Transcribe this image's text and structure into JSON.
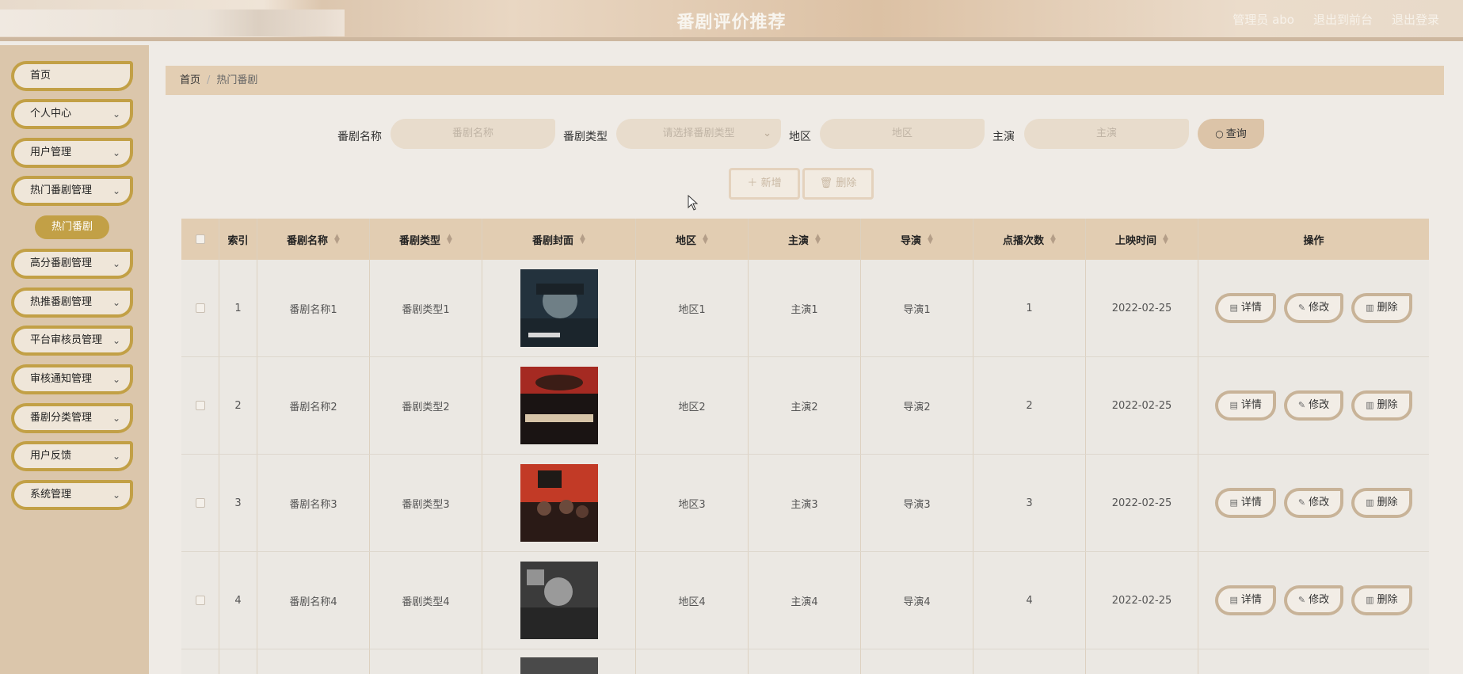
{
  "header": {
    "title": "番剧评价推荐",
    "user": "管理员 abo",
    "to_front": "退出到前台",
    "logout": "退出登录"
  },
  "sidebar": {
    "items": [
      {
        "label": "首页",
        "has_arrow": false
      },
      {
        "label": "个人中心",
        "has_arrow": true
      },
      {
        "label": "用户管理",
        "has_arrow": true
      },
      {
        "label": "热门番剧管理",
        "has_arrow": true
      },
      {
        "label": "高分番剧管理",
        "has_arrow": true
      },
      {
        "label": "热推番剧管理",
        "has_arrow": true
      },
      {
        "label": "平台审核员管理",
        "has_arrow": true
      },
      {
        "label": "审核通知管理",
        "has_arrow": true
      },
      {
        "label": "番剧分类管理",
        "has_arrow": true
      },
      {
        "label": "用户反馈",
        "has_arrow": true
      },
      {
        "label": "系统管理",
        "has_arrow": true
      }
    ],
    "active_sub": "热门番剧"
  },
  "breadcrumb": {
    "home": "首页",
    "sep": "/",
    "current": "热门番剧"
  },
  "search": {
    "name_label": "番剧名称",
    "name_placeholder": "番剧名称",
    "type_label": "番剧类型",
    "type_placeholder": "请选择番剧类型",
    "region_label": "地区",
    "region_placeholder": "地区",
    "actor_label": "主演",
    "actor_placeholder": "主演",
    "query": "查询"
  },
  "toolbar": {
    "add": "新增",
    "delete": "删除"
  },
  "table": {
    "headers": [
      "索引",
      "番剧名称",
      "番剧类型",
      "番剧封面",
      "地区",
      "主演",
      "导演",
      "点播次数",
      "上映时间",
      "操作"
    ],
    "rows": [
      {
        "index": "1",
        "name": "番剧名称1",
        "type": "番剧类型1",
        "region": "地区1",
        "actor": "主演1",
        "director": "导演1",
        "plays": "1",
        "date": "2022-02-25"
      },
      {
        "index": "2",
        "name": "番剧名称2",
        "type": "番剧类型2",
        "region": "地区2",
        "actor": "主演2",
        "director": "导演2",
        "plays": "2",
        "date": "2022-02-25"
      },
      {
        "index": "3",
        "name": "番剧名称3",
        "type": "番剧类型3",
        "region": "地区3",
        "actor": "主演3",
        "director": "导演3",
        "plays": "3",
        "date": "2022-02-25"
      },
      {
        "index": "4",
        "name": "番剧名称4",
        "type": "番剧类型4",
        "region": "地区4",
        "actor": "主演4",
        "director": "导演4",
        "plays": "4",
        "date": "2022-02-25"
      }
    ],
    "actions": {
      "detail": "详情",
      "edit": "修改",
      "delete": "删除"
    }
  },
  "colors": {
    "accent": "#c2a046",
    "sidebar": "#dbc6ab",
    "table_header": "#e2cdb2"
  }
}
